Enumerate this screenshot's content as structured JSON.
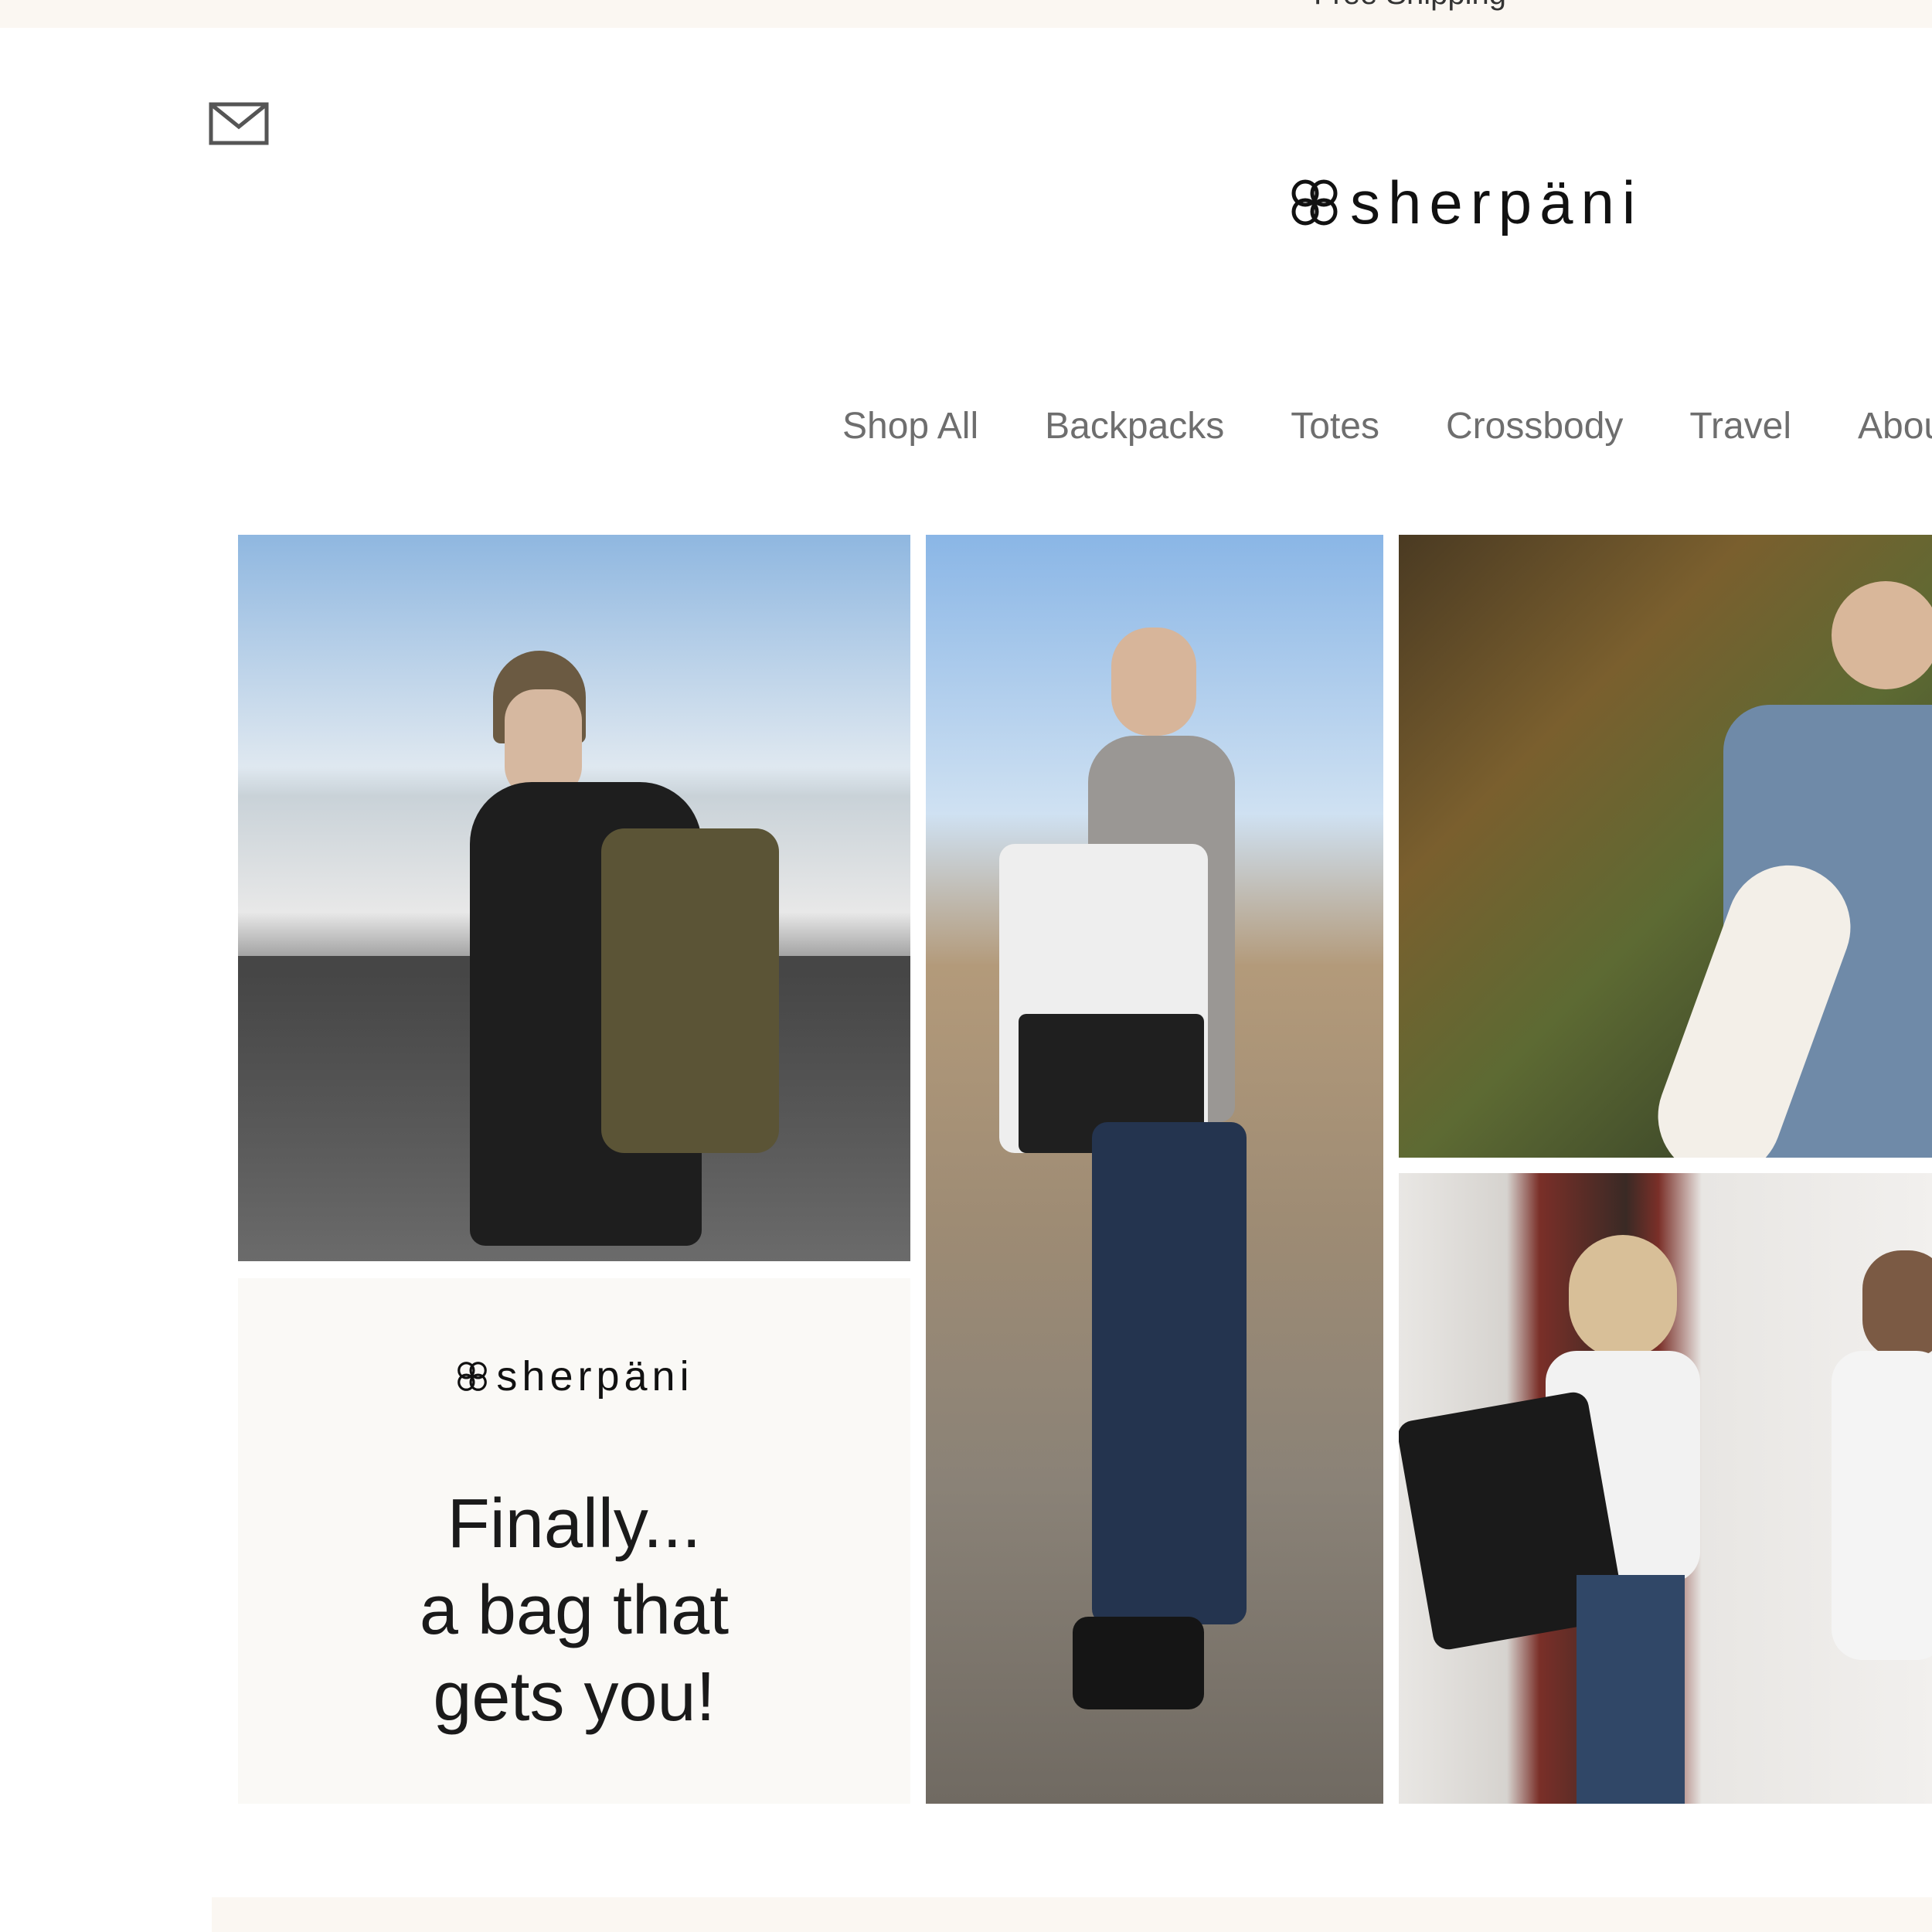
{
  "announcement": {
    "text": "Free Shipping"
  },
  "header": {
    "logo_text": "sherpäni",
    "mail_icon": "envelope-icon"
  },
  "nav": {
    "items": [
      {
        "label": "Shop All"
      },
      {
        "label": "Backpacks"
      },
      {
        "label": "Totes"
      },
      {
        "label": "Crossbody"
      },
      {
        "label": "Travel"
      },
      {
        "label": "About"
      }
    ]
  },
  "hero": {
    "promo": {
      "logo_text": "sherpäni",
      "line1": "Finally...",
      "line2": "a bag that",
      "line3": "gets you!"
    }
  },
  "colors": {
    "announcement_bg": "#fbf7f2",
    "nav_text": "#6e6e6e",
    "promo_bg": "#faf9f6"
  }
}
